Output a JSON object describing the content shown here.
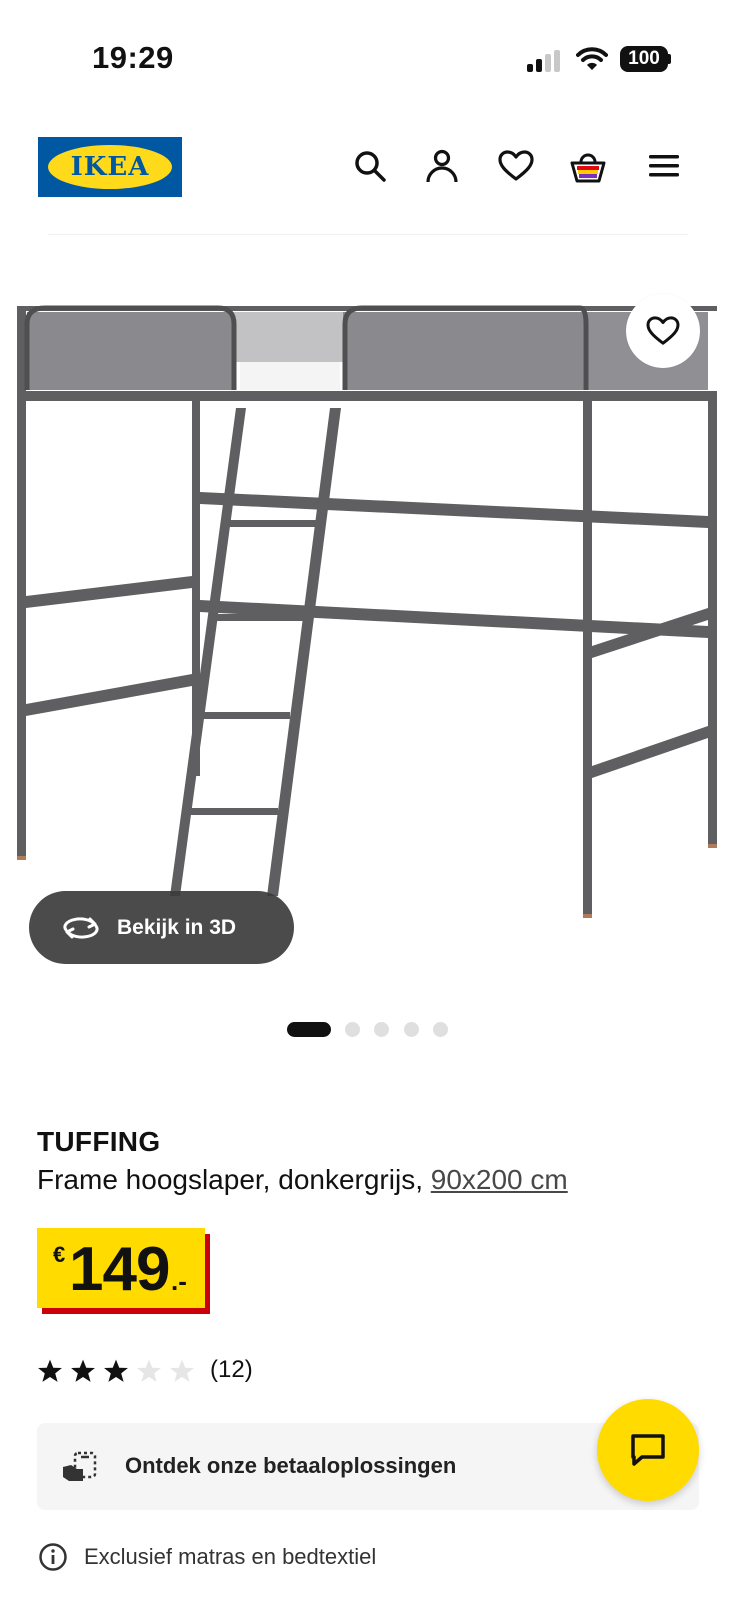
{
  "status_bar": {
    "time": "19:29",
    "battery": "100"
  },
  "header": {
    "logo_text": "IKEA",
    "icons": [
      "search-icon",
      "account-icon",
      "heart-icon",
      "basket-icon",
      "menu-icon"
    ]
  },
  "gallery": {
    "view_3d_label": "Bekijk in 3D",
    "slide_count": 5,
    "active_slide": 1
  },
  "product": {
    "name": "TUFFING",
    "description": "Frame hoogslaper, donkergrijs,",
    "size": "90x200 cm",
    "price": {
      "currency": "€",
      "integer": "149",
      "decimal": ".-"
    },
    "rating": {
      "stars": 3,
      "max": 5,
      "count": "(12)"
    }
  },
  "payment": {
    "label": "Ontdek onze betaaloplossingen"
  },
  "info": {
    "text": "Exclusief matras en bedtextiel"
  },
  "colors": {
    "ikea_blue": "#0058a3",
    "ikea_yellow": "#ffdb00",
    "price_red": "#cc0008",
    "frame_grey": "#5f5f62"
  }
}
